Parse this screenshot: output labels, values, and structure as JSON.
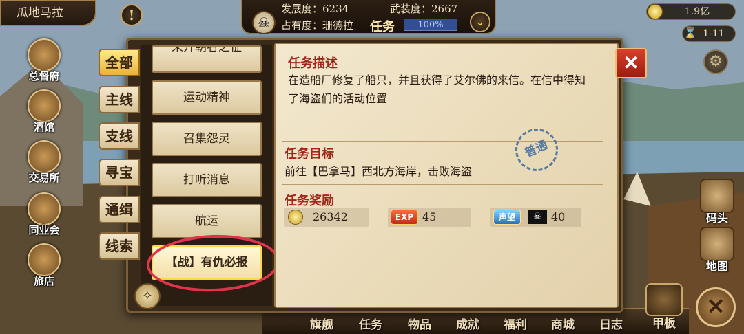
{
  "top_bar": {
    "city_name": "瓜地马拉",
    "development_label": "发展度：",
    "development_value": "6234",
    "military_label": "武装度：",
    "military_value": "2667",
    "occupancy_label": "占有度：",
    "occupancy_value": "珊德拉",
    "task_label": "任务",
    "progress_text": "100%",
    "progress_value": 1.0,
    "alert_glyph": "!",
    "chevron_glyph": "⌄",
    "gold": "1.9亿",
    "date": "1-11",
    "gear_glyph": "⚙",
    "skull_glyph": "☠",
    "hourglass_glyph": "⌛"
  },
  "left_menu": {
    "items": [
      {
        "label": "总督府",
        "icon": "crown-icon"
      },
      {
        "label": "酒馆",
        "icon": "tavern-icon"
      },
      {
        "label": "交易所",
        "icon": "scales-icon"
      },
      {
        "label": "同业会",
        "icon": "guild-icon"
      },
      {
        "label": "旅店",
        "icon": "inn-icon"
      }
    ]
  },
  "right_nav": {
    "items": [
      {
        "label": "码头",
        "icon": "dock-icon"
      },
      {
        "label": "地图",
        "icon": "map-icon"
      }
    ]
  },
  "bottom_nav": {
    "items": [
      "旗舰",
      "任务",
      "物品",
      "成就",
      "福利",
      "商城",
      "日志"
    ],
    "deck_label": "甲板",
    "close_glyph": "✕"
  },
  "categories": [
    "全部",
    "主线",
    "支线",
    "寻宝",
    "通缉",
    "线索"
  ],
  "active_category_index": 0,
  "quests": [
    "采开朝者之征",
    "运动精神",
    "召集怨灵",
    "打听消息",
    "航运",
    "【战】有仇必报"
  ],
  "active_quest_index": 5,
  "detail": {
    "description_heading": "任务描述",
    "description": "在造船厂修复了船只，并且获得了艾尔佛的来信。在信中得知了海盗们的活动位置",
    "objective_heading": "任务目标",
    "objective": "前往【巴拿马】西北方海岸，击败海盗",
    "stamp": "普通",
    "reward_heading": "任务奖励",
    "rewards": {
      "gold": "26342",
      "exp_badge": "EXP",
      "exp": "45",
      "reputation_badge": "声望",
      "reputation_icon": "☠",
      "reputation": "40"
    },
    "close_glyph": "✕"
  },
  "compass_glyph": "✧",
  "colors": {
    "accent_red": "#a3261a",
    "active_tab": "#e9b43a",
    "annotation_circle": "#e2334d",
    "parchment": "#f3e8cf"
  }
}
